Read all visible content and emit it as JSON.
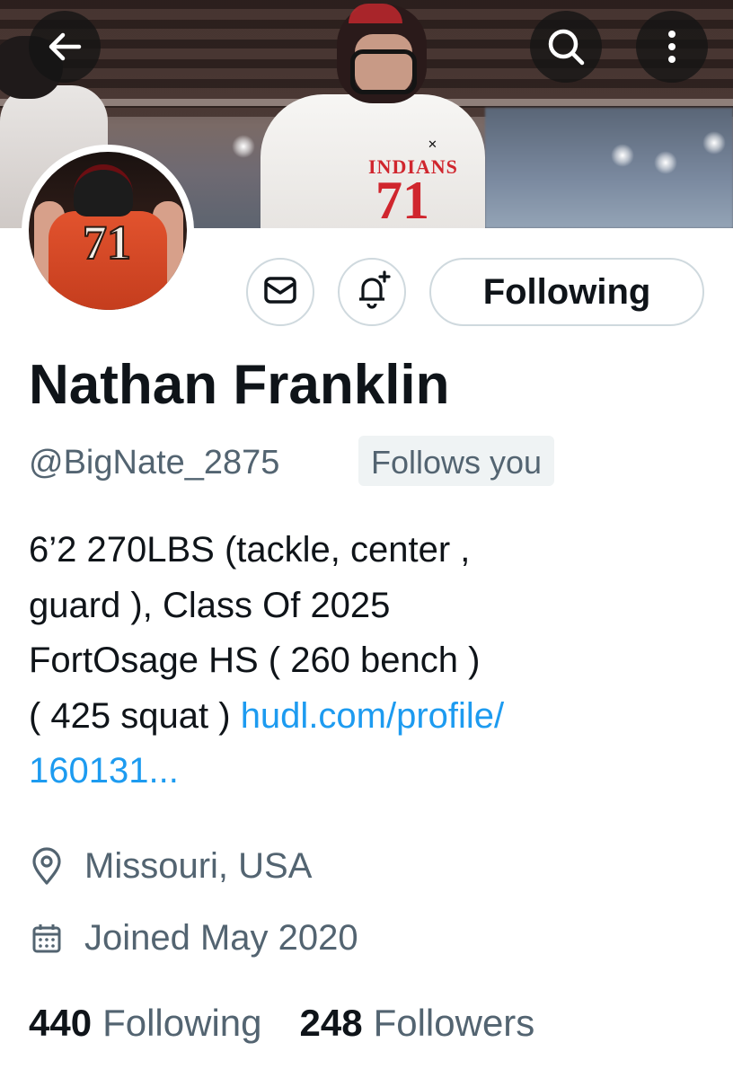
{
  "header": {
    "back_icon": "arrow-left-icon",
    "search_icon": "search-icon",
    "more_icon": "more-vertical-icon",
    "banner_team_text": "INDIANS",
    "banner_jersey_number": "71",
    "avatar_jersey_number": "71"
  },
  "actions": {
    "message_icon": "envelope-icon",
    "notify_icon": "bell-plus-icon",
    "follow_label": "Following"
  },
  "profile": {
    "name": "Nathan Franklin",
    "handle": "@BigNate_2875",
    "follows_you": "Follows you",
    "bio_line1": "6’2 270LBS (tackle, center ,",
    "bio_line2": "guard ), Class Of 2025",
    "bio_line3": "FortOsage HS ( 260 bench )",
    "bio_line4_text": "( 425 squat ) ",
    "bio_link_part1": "hudl.com/profile/",
    "bio_link_part2": "160131...",
    "location": "Missouri, USA",
    "joined": "Joined May 2020"
  },
  "stats": {
    "following_count": "440",
    "following_label": "Following",
    "followers_count": "248",
    "followers_label": "Followers"
  },
  "colors": {
    "link": "#1d9bf0",
    "secondary_text": "#536471",
    "primary_text": "#0f1419",
    "border": "#cfd9de"
  }
}
